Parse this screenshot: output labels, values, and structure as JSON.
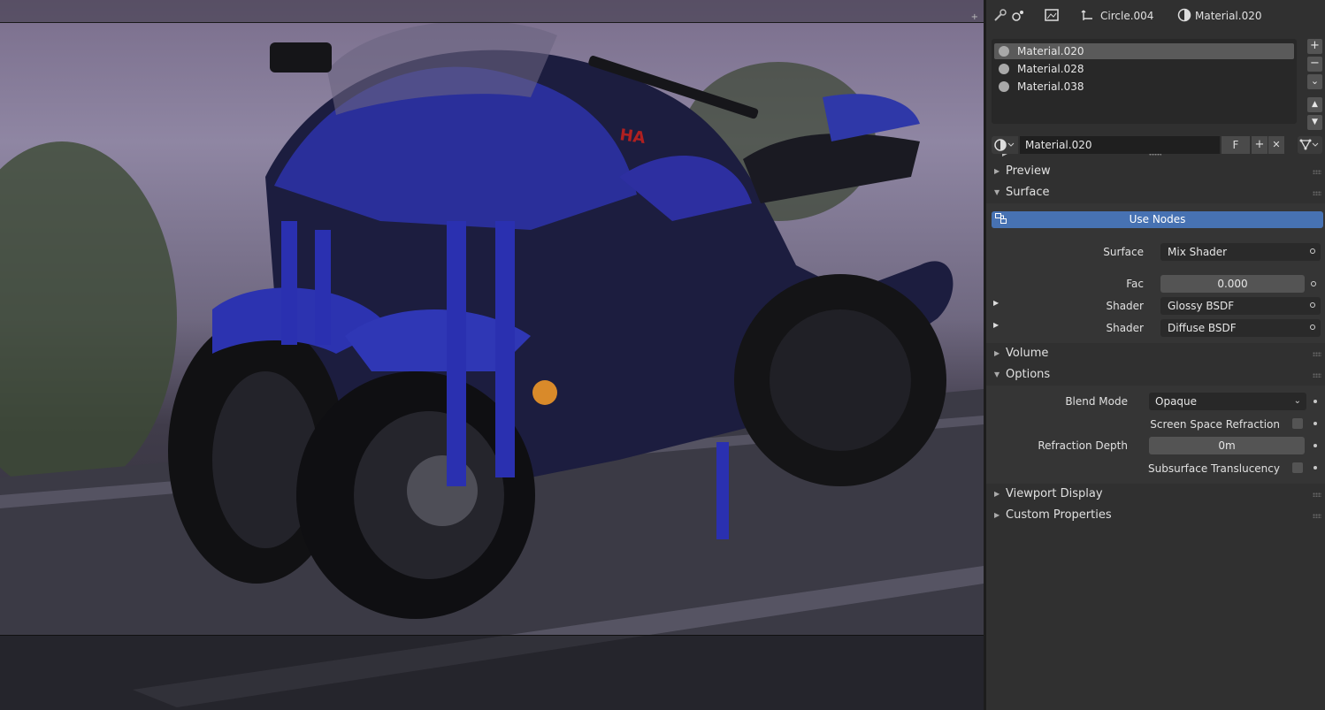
{
  "header": {
    "object_name": "Circle.004",
    "material_name": "Material.020"
  },
  "material_slots": [
    {
      "label": "Material.020",
      "active": true
    },
    {
      "label": "Material.028",
      "active": false
    },
    {
      "label": "Material.038",
      "active": false
    }
  ],
  "slot_buttons": {
    "add": "+",
    "remove": "−",
    "menu": "⌄",
    "up": "▲",
    "down": "▼"
  },
  "material_selector": {
    "name": "Material.020",
    "fake_user": "F",
    "new": "+",
    "unlink": "✕"
  },
  "sections": {
    "preview": "Preview",
    "surface": "Surface",
    "volume": "Volume",
    "options": "Options",
    "viewport_display": "Viewport Display",
    "custom_properties": "Custom Properties"
  },
  "surface": {
    "use_nodes": "Use Nodes",
    "surface_label": "Surface",
    "surface_value": "Mix Shader",
    "fac_label": "Fac",
    "fac_value": "0.000",
    "shader1_label": "Shader",
    "shader1_value": "Glossy BSDF",
    "shader2_label": "Shader",
    "shader2_value": "Diffuse BSDF"
  },
  "options": {
    "blend_mode_label": "Blend Mode",
    "blend_mode_value": "Opaque",
    "ssr_label": "Screen Space Refraction",
    "ssr_checked": false,
    "refraction_depth_label": "Refraction Depth",
    "refraction_depth_value": "0m",
    "subsurface_label": "Subsurface Translucency",
    "subsurface_checked": false
  },
  "colors": {
    "accent": "#4772b3",
    "panel_bg": "#303030",
    "field_bg": "#2a2a2a"
  }
}
